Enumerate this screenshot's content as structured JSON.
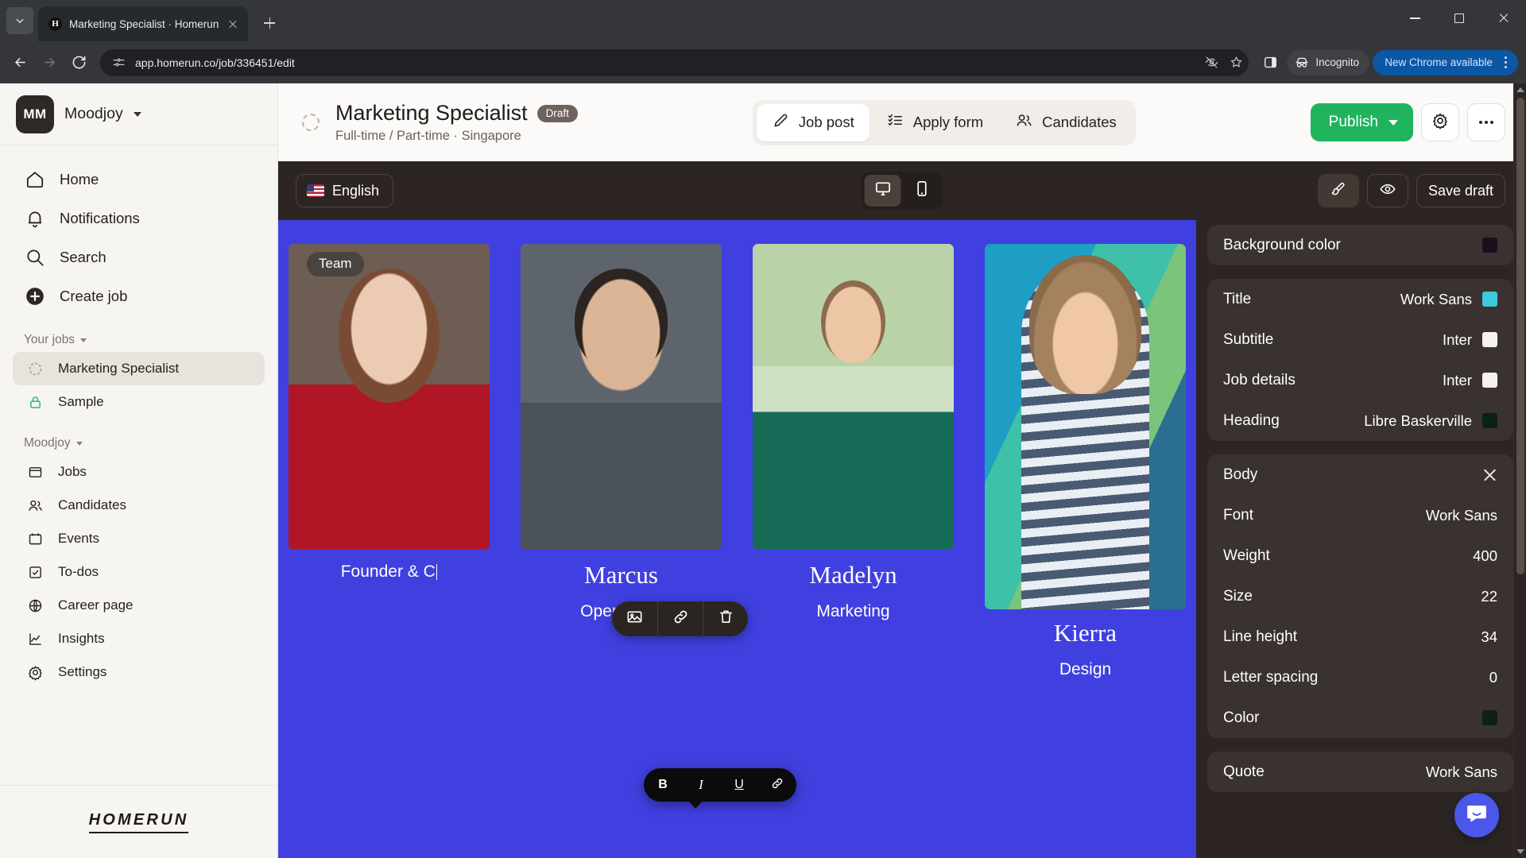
{
  "browser": {
    "tab": {
      "title": "Marketing Specialist · Homerun",
      "favicon_letter": "H"
    },
    "new_tab_label": "+",
    "url": "app.homerun.co/job/336451/edit",
    "incognito_label": "Incognito",
    "update_label": "New Chrome available"
  },
  "sidebar": {
    "org": {
      "initials": "MM",
      "name": "Moodjoy"
    },
    "nav": [
      {
        "label": "Home",
        "icon": "home-icon"
      },
      {
        "label": "Notifications",
        "icon": "bell-icon"
      },
      {
        "label": "Search",
        "icon": "search-icon"
      },
      {
        "label": "Create job",
        "icon": "plus-circle-icon"
      }
    ],
    "your_jobs_label": "Your jobs",
    "jobs": [
      {
        "label": "Marketing Specialist",
        "icon": "dashed-circle-icon",
        "active": true
      },
      {
        "label": "Sample",
        "icon": "lock-icon",
        "active": false
      }
    ],
    "workspace_label": "Moodjoy",
    "workspace_nav": [
      {
        "label": "Jobs",
        "icon": "board-icon"
      },
      {
        "label": "Candidates",
        "icon": "people-icon"
      },
      {
        "label": "Events",
        "icon": "calendar-icon"
      },
      {
        "label": "To-dos",
        "icon": "checkbox-icon"
      },
      {
        "label": "Career page",
        "icon": "globe-icon"
      },
      {
        "label": "Insights",
        "icon": "chart-line-icon"
      },
      {
        "label": "Settings",
        "icon": "gear-icon"
      }
    ],
    "footer_logo": "HOMERUN"
  },
  "job_header": {
    "title": "Marketing Specialist",
    "badge": "Draft",
    "subtitle": "Full-time / Part-time · Singapore",
    "tabs": [
      {
        "label": "Job post",
        "icon": "pencil-icon",
        "active": true
      },
      {
        "label": "Apply form",
        "icon": "checklist-icon",
        "active": false
      },
      {
        "label": "Candidates",
        "icon": "people-icon",
        "active": false
      }
    ],
    "publish_label": "Publish",
    "settings_icon": "gear-icon",
    "more_icon": "ellipsis-icon"
  },
  "editor_bar": {
    "language": "English",
    "language_flag": "us-flag-icon",
    "devices": [
      {
        "name": "desktop-icon",
        "active": true
      },
      {
        "name": "mobile-icon",
        "active": false
      }
    ],
    "brush_icon": "paintbrush-icon",
    "preview_icon": "eye-icon",
    "save_draft_label": "Save draft"
  },
  "canvas": {
    "background_color": "#4040e0",
    "section_badge": "Team",
    "image_toolbar": [
      "image-icon",
      "link-icon",
      "trash-icon"
    ],
    "person_toolbar": [
      "person-icon",
      "style-icon",
      "ellipsis-icon"
    ],
    "text_toolbar": [
      "B",
      "I",
      "U",
      "link-icon"
    ],
    "members": [
      {
        "name": "",
        "role": "Founder & C",
        "editing": true
      },
      {
        "name": "Marcus",
        "role": "Operations",
        "editing": false
      },
      {
        "name": "Madelyn",
        "role": "Marketing",
        "editing": false
      },
      {
        "name": "Kierra",
        "role": "Design",
        "editing": false
      }
    ]
  },
  "panel": {
    "background": {
      "label": "Background color",
      "swatch": "#1a0f1c"
    },
    "typography": [
      {
        "label": "Title",
        "value": "Work Sans",
        "swatch": "#3ec8dc"
      },
      {
        "label": "Subtitle",
        "value": "Inter",
        "swatch": "#f6f1ee"
      },
      {
        "label": "Job details",
        "value": "Inter",
        "swatch": "#f6f1ee"
      },
      {
        "label": "Heading",
        "value": "Libre Baskerville",
        "swatch": "#0d2018"
      }
    ],
    "body": {
      "title": "Body",
      "close_icon": "close-icon",
      "rows": [
        {
          "label": "Font",
          "value": "Work Sans"
        },
        {
          "label": "Weight",
          "value": "400"
        },
        {
          "label": "Size",
          "value": "22"
        },
        {
          "label": "Line height",
          "value": "34"
        },
        {
          "label": "Letter spacing",
          "value": "0"
        },
        {
          "label": "Color",
          "value": "",
          "swatch": "#0d2018"
        }
      ]
    },
    "quote": {
      "label": "Quote",
      "value": "Work Sans"
    }
  },
  "intercom": {
    "icon": "chat-icon"
  }
}
